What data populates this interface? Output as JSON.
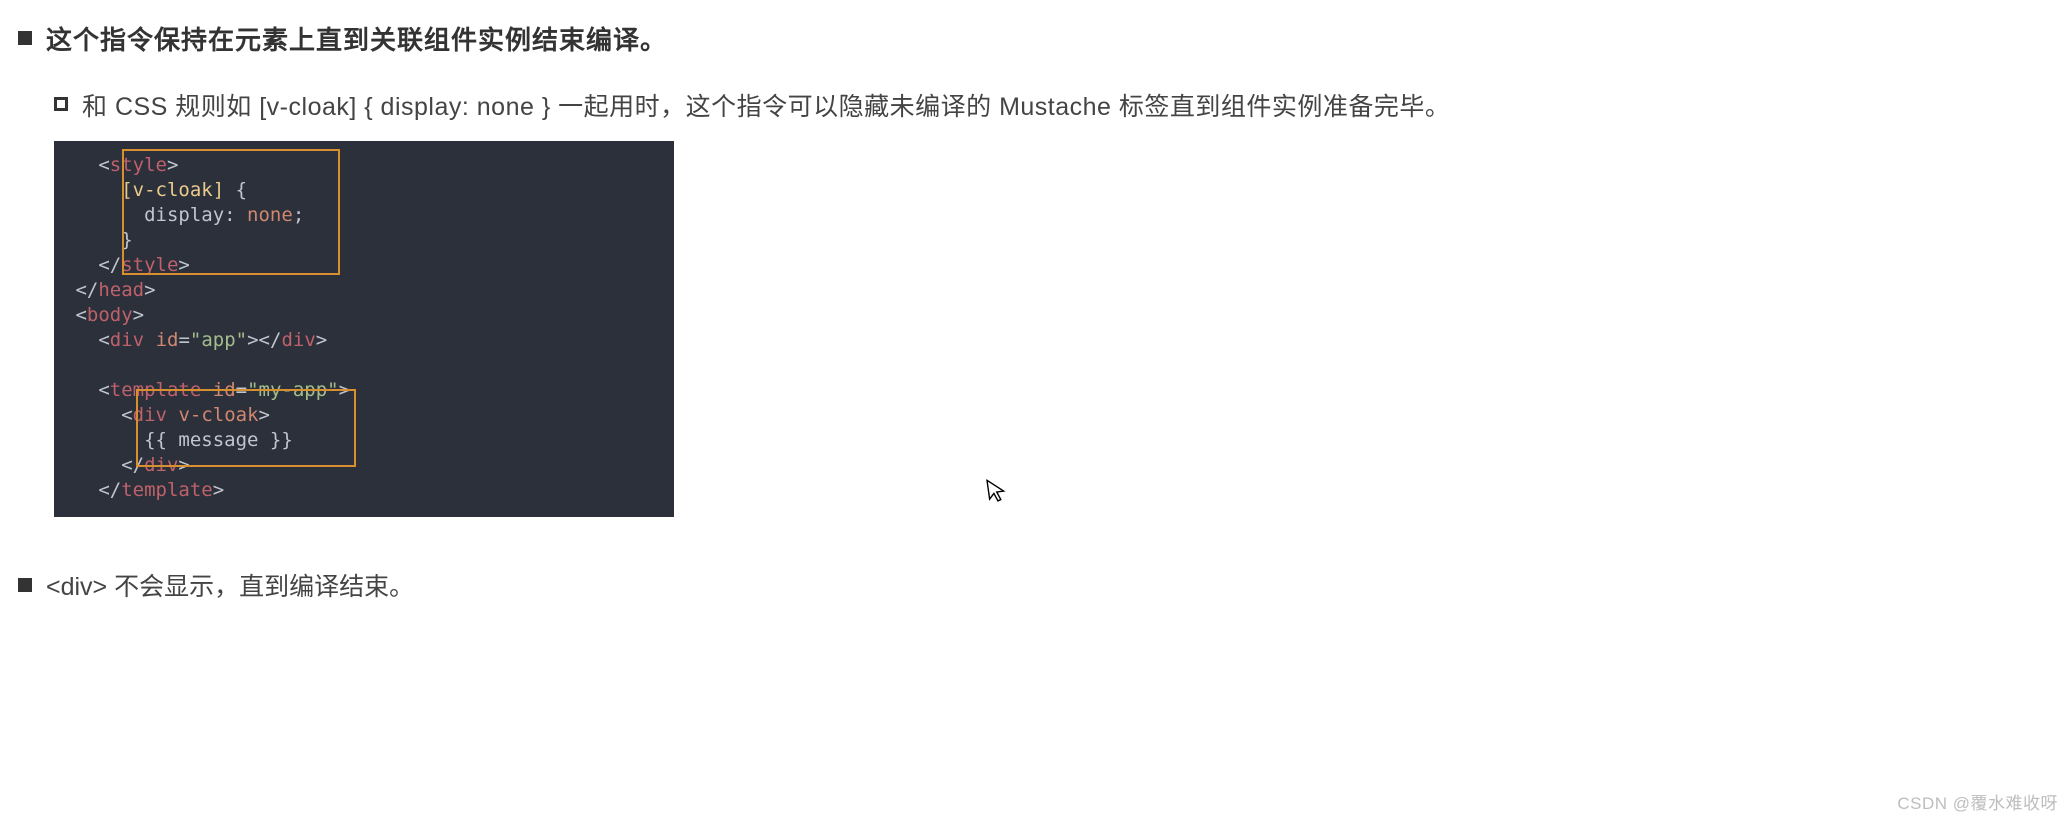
{
  "bullets": {
    "b1": "这个指令保持在元素上直到关联组件实例结束编译。",
    "sub1": "和 CSS 规则如 [v-cloak] { display: none } 一起用时，这个指令可以隐藏未编译的 Mustache 标签直到组件实例准备完毕。",
    "b2": "<div> 不会显示，直到编译结束。"
  },
  "code": {
    "l01a": "<",
    "l01b": "style",
    "l01c": ">",
    "l02a": "[v-cloak]",
    "l02b": " {",
    "l03a": "display",
    "l03b": ": ",
    "l03c": "none",
    "l03d": ";",
    "l04a": "}",
    "l05a": "</",
    "l05b": "style",
    "l05c": ">",
    "l06a": "</",
    "l06b": "head",
    "l06c": ">",
    "l07a": "<",
    "l07b": "body",
    "l07c": ">",
    "l08a": "<",
    "l08b": "div",
    "l08c": " ",
    "l08d": "id",
    "l08e": "=",
    "l08f": "\"app\"",
    "l08g": "></",
    "l08h": "div",
    "l08i": ">",
    "l09_blank": " ",
    "l10a": "<",
    "l10b": "template",
    "l10c": " ",
    "l10d": "id",
    "l10e": "=",
    "l10f": "\"my-app\"",
    "l10g": ">",
    "l11a": "<",
    "l11b": "div",
    "l11c": " ",
    "l11d": "v-cloak",
    "l11e": ">",
    "l12a": "{{ message }}",
    "l13a": "</",
    "l13b": "div",
    "l13c": ">",
    "l14a": "</",
    "l14b": "template",
    "l14c": ">"
  },
  "watermark": "CSDN @覆水难收呀"
}
